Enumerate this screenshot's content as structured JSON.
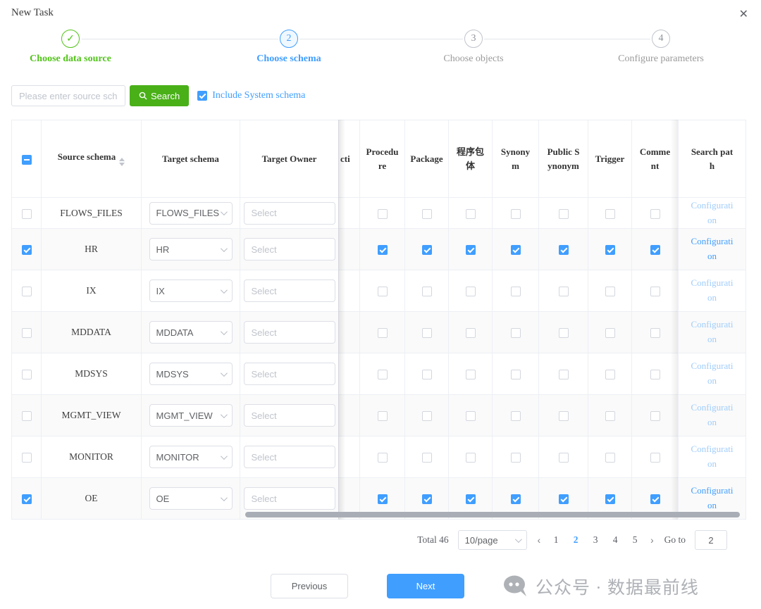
{
  "dialog": {
    "title": "New Task",
    "close": "✕"
  },
  "steps": {
    "items": [
      {
        "num": "✓",
        "label": "Choose data source",
        "state": "done"
      },
      {
        "num": "2",
        "label": "Choose schema",
        "state": "active"
      },
      {
        "num": "3",
        "label": "Choose objects",
        "state": "wait"
      },
      {
        "num": "4",
        "label": "Configure parameters",
        "state": "wait"
      }
    ]
  },
  "toolbar": {
    "search_placeholder": "Please enter source sch",
    "search_label": "Search",
    "include_system_label": "Include System schema",
    "include_system_checked": true
  },
  "table": {
    "header_checkbox": "indeterminate",
    "headers": {
      "source": "Source schema",
      "target": "Target schema",
      "owner": "Target Owner",
      "partial": "cti",
      "object_types": [
        "Procedure",
        "Package",
        "程序包体",
        "Synonym",
        "Public Synonym",
        "Trigger",
        "Comment"
      ],
      "search_path": "Search path"
    },
    "select_placeholder": "Select",
    "config_link": "Configuration",
    "rows": [
      {
        "source": "FLOWS_FILES",
        "target": "FLOWS_FILES",
        "checked": false
      },
      {
        "source": "HR",
        "target": "HR",
        "checked": true
      },
      {
        "source": "IX",
        "target": "IX",
        "checked": false
      },
      {
        "source": "MDDATA",
        "target": "MDDATA",
        "checked": false
      },
      {
        "source": "MDSYS",
        "target": "MDSYS",
        "checked": false
      },
      {
        "source": "MGMT_VIEW",
        "target": "MGMT_VIEW",
        "checked": false
      },
      {
        "source": "MONITOR",
        "target": "MONITOR",
        "checked": false
      },
      {
        "source": "OE",
        "target": "OE",
        "checked": true
      }
    ]
  },
  "pagination": {
    "total": "Total 46",
    "per_page": "10/page",
    "pages": [
      "1",
      "2",
      "3",
      "4",
      "5"
    ],
    "active_page": "2",
    "prev_arrow": "‹",
    "next_arrow": "›",
    "goto_label": "Go to",
    "goto_value": "2"
  },
  "footer": {
    "previous": "Previous",
    "next": "Next",
    "watermark": "公众号 · 数据最前线"
  },
  "colors": {
    "accent_blue": "#409eff",
    "accent_green": "#52c41a",
    "search_button_green": "#49b018",
    "link_disabled": "#a0cdfb"
  }
}
